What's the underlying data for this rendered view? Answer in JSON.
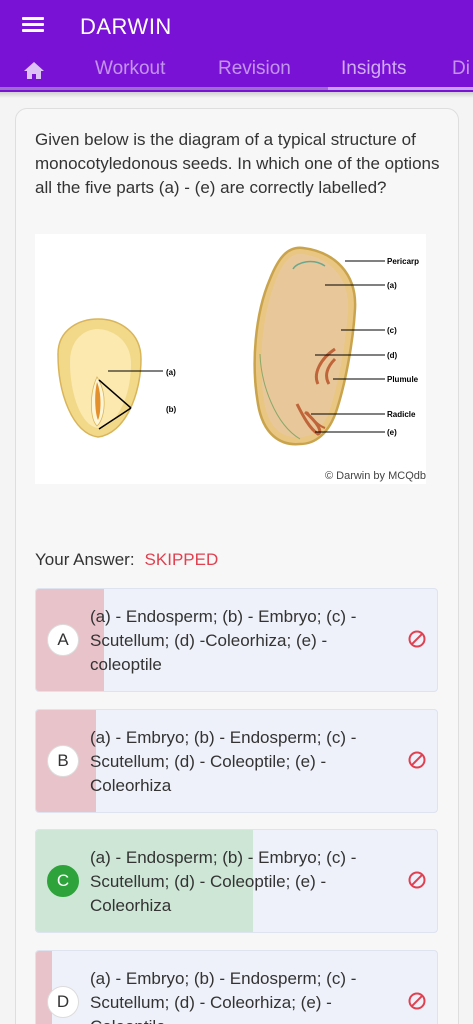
{
  "app": {
    "title": "DARWIN"
  },
  "tabs": [
    {
      "label": "Workout"
    },
    {
      "label": "Revision"
    },
    {
      "label": "Insights"
    },
    {
      "label": "Di"
    }
  ],
  "question": {
    "text": "Given below is the diagram of a typical structure of monocotyledonous seeds. In which one of the options all the five parts (a) - (e) are correctly labelled?"
  },
  "figure": {
    "left_labels": [
      "(a)",
      "(b)"
    ],
    "right_labels": [
      "Pericarp",
      "(a)",
      "(c)",
      "(d)",
      "Plumule",
      "Radicle",
      "(e)"
    ],
    "credit": "© Darwin by MCQdb"
  },
  "answer": {
    "label": "Your Answer:",
    "status": "SKIPPED"
  },
  "colors": {
    "accent": "#7a12d6",
    "wrong_fill": "#e8c3c9",
    "correct_fill": "#cde6d5",
    "correct_badge": "#2ea33b",
    "skipped": "#e04050"
  },
  "options": [
    {
      "letter": "A",
      "text": "(a) - Endosperm; (b) - Embryo; (c) - Scutellum; (d) -Coleorhiza; (e) - coleoptile",
      "fill_percent": 17,
      "correct": false,
      "icon": "block-icon"
    },
    {
      "letter": "B",
      "text": "(a) - Embryo; (b) - Endosperm; (c) - Scutellum; (d) - Coleoptile; (e) - Coleorhiza",
      "fill_percent": 15,
      "correct": false,
      "icon": "block-icon"
    },
    {
      "letter": "C",
      "text": "(a) - Endosperm; (b) - Embryo; (c) - Scutellum; (d) - Coleoptile; (e) - Coleorhiza",
      "fill_percent": 54,
      "correct": true,
      "icon": "block-icon"
    },
    {
      "letter": "D",
      "text": "(a) - Embryo; (b) - Endosperm; (c) - Scutellum; (d) - Coleorhiza; (e) - Coleoptile",
      "fill_percent": 4,
      "correct": false,
      "icon": "block-icon"
    }
  ]
}
